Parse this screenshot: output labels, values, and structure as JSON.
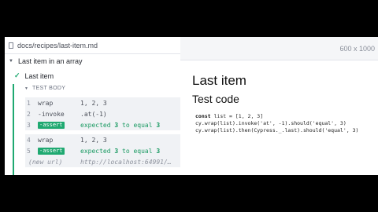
{
  "reporter": {
    "spec_path": "docs/recipes/last-item.md",
    "suite_title": "Last item in an array",
    "test_title": "Last item",
    "test_body_label": "TEST BODY",
    "commands_group_1": [
      {
        "num": "1",
        "name": "wrap",
        "msg": "1, 2, 3"
      },
      {
        "num": "2",
        "name": "-invoke",
        "msg": ".at(-1)"
      },
      {
        "num": "3",
        "name": "-assert",
        "msg_prefix": "expected",
        "msg_a": "3",
        "msg_mid": "to equal",
        "msg_b": "3"
      }
    ],
    "commands_group_2": [
      {
        "num": "4",
        "name": "wrap",
        "msg": "1, 2, 3"
      },
      {
        "num": "5",
        "name": "-assert",
        "msg_prefix": "expected",
        "msg_a": "3",
        "msg_mid": "to equal",
        "msg_b": "3"
      }
    ],
    "new_url": {
      "label": "(new url)",
      "value": "http://localhost:64991/…"
    }
  },
  "preview": {
    "viewport_size": "600 x 1000",
    "heading": "Last item",
    "subheading": "Test code",
    "code": {
      "line1_kw": "const",
      "line1_rest": " list = [1, 2, 3]",
      "line2": "cy.wrap(list).invoke('at', -1).should('equal', 3)",
      "line3": "cy.wrap(list).then(Cypress._.last).should('equal', 3)"
    }
  }
}
